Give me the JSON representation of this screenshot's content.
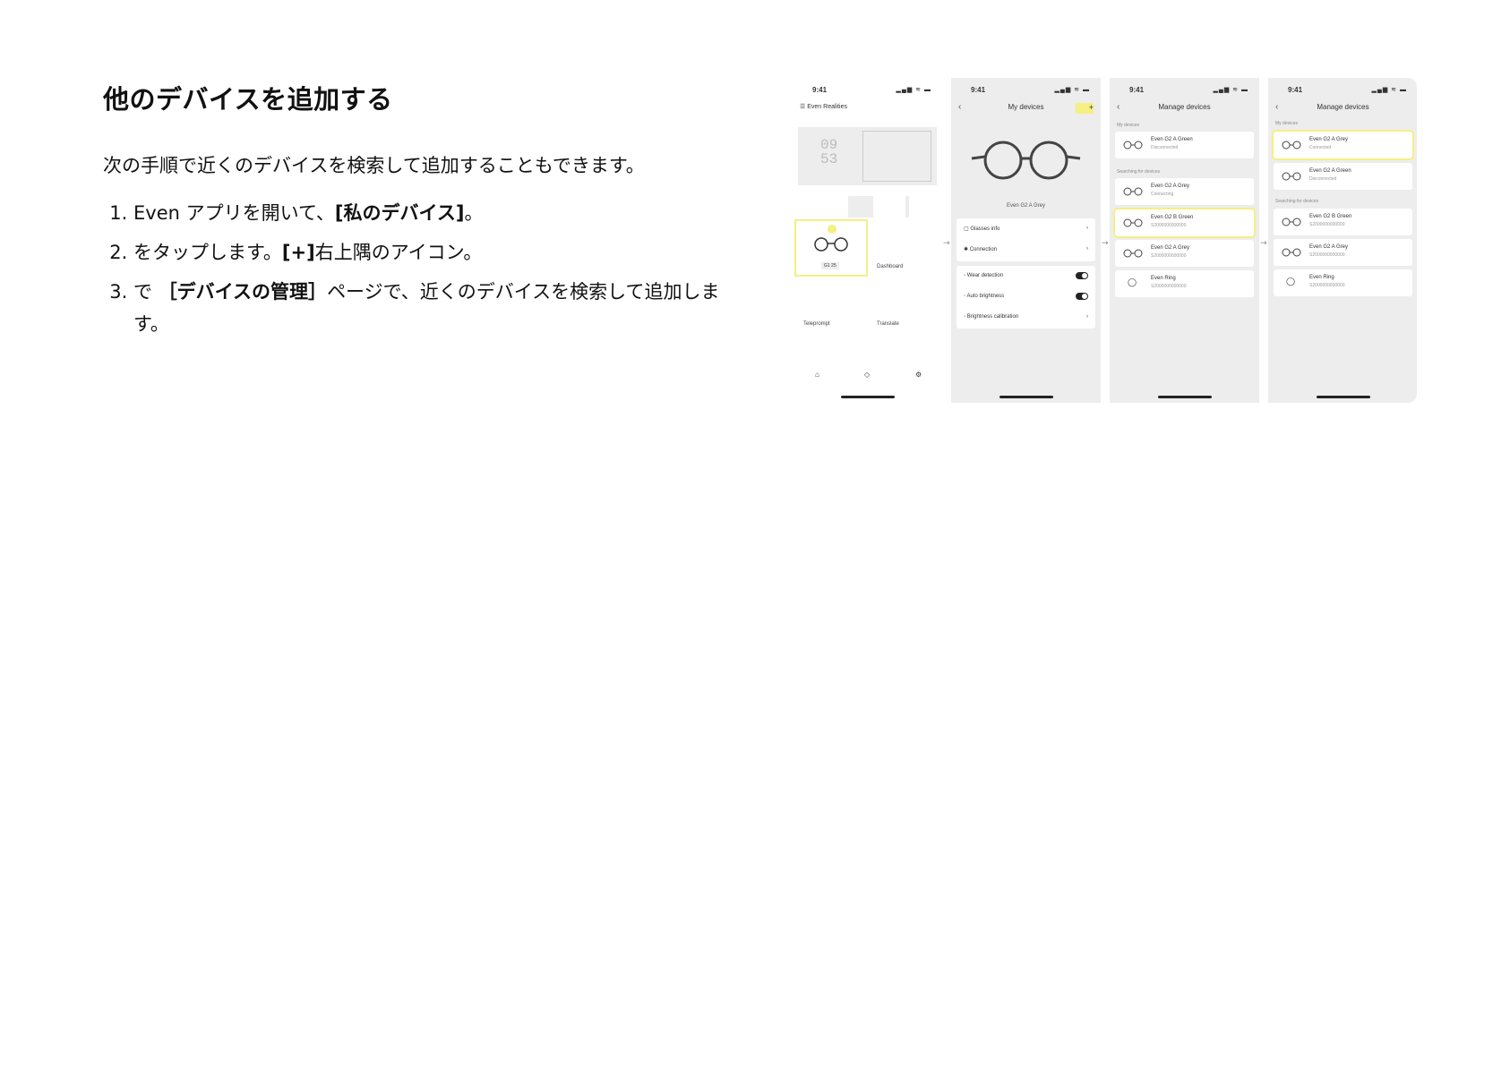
{
  "doc": {
    "title": "他のデバイスを追加する",
    "intro": "次の手順で近くのデバイスを検索して追加することもできます。",
    "steps": [
      {
        "pre": "Even アプリを開いて、",
        "bold": "[私のデバイス]",
        "post": "。"
      },
      {
        "pre": "をタップします。",
        "bold": "[+]",
        "post": "右上隅のアイコン。"
      },
      {
        "pre": "で ",
        "bold": "［デバイスの管理］",
        "post": "ページで、近くのデバイスを検索して追加します。"
      }
    ]
  },
  "screens": {
    "time": "9:41",
    "status_icons": "▂▄▆ ≋ ▬",
    "s1": {
      "app_title": "Even Realities",
      "clock_top": "09",
      "clock_bottom": "53",
      "battery_label": "G1 25",
      "tiles": [
        "Dashboard",
        "Teleprompt",
        "Translate"
      ]
    },
    "s2": {
      "header": "My devices",
      "device_name": "Even G2 A Grey",
      "menu": [
        "Glasses info",
        "Connection"
      ],
      "toggles": [
        "Wear detection",
        "Auto brightness"
      ],
      "last_item": "Brightness calibration"
    },
    "s3": {
      "header": "Manage devices",
      "section_mine": "My devices",
      "section_search": "Searching for devices",
      "mine": {
        "name": "Even G2 A Green",
        "sub": "Disconnected"
      },
      "connecting": {
        "name": "Even G2 A Grey",
        "sub": "Connecting"
      },
      "found": [
        {
          "name": "Even G2 B Green",
          "sub": "S2000000000000"
        },
        {
          "name": "Even G2 A Grey",
          "sub": "S2000000000000"
        },
        {
          "name": "Even Ring",
          "sub": "S2000000000000"
        }
      ]
    },
    "s4": {
      "header": "Manage devices",
      "section_mine": "My devices",
      "section_search": "Searching for devices",
      "mine": [
        {
          "name": "Even G2 A Grey",
          "sub": "Connected"
        },
        {
          "name": "Even G2 A Green",
          "sub": "Disconnected"
        }
      ],
      "found": [
        {
          "name": "Even G2 B Green",
          "sub": "S2000000000000"
        },
        {
          "name": "Even G2 A Grey",
          "sub": "S2000000000000"
        },
        {
          "name": "Even Ring",
          "sub": "S2000000000000"
        }
      ]
    }
  },
  "colors": {
    "highlight": "#f6ef83",
    "screen_bg": "#ededed"
  }
}
